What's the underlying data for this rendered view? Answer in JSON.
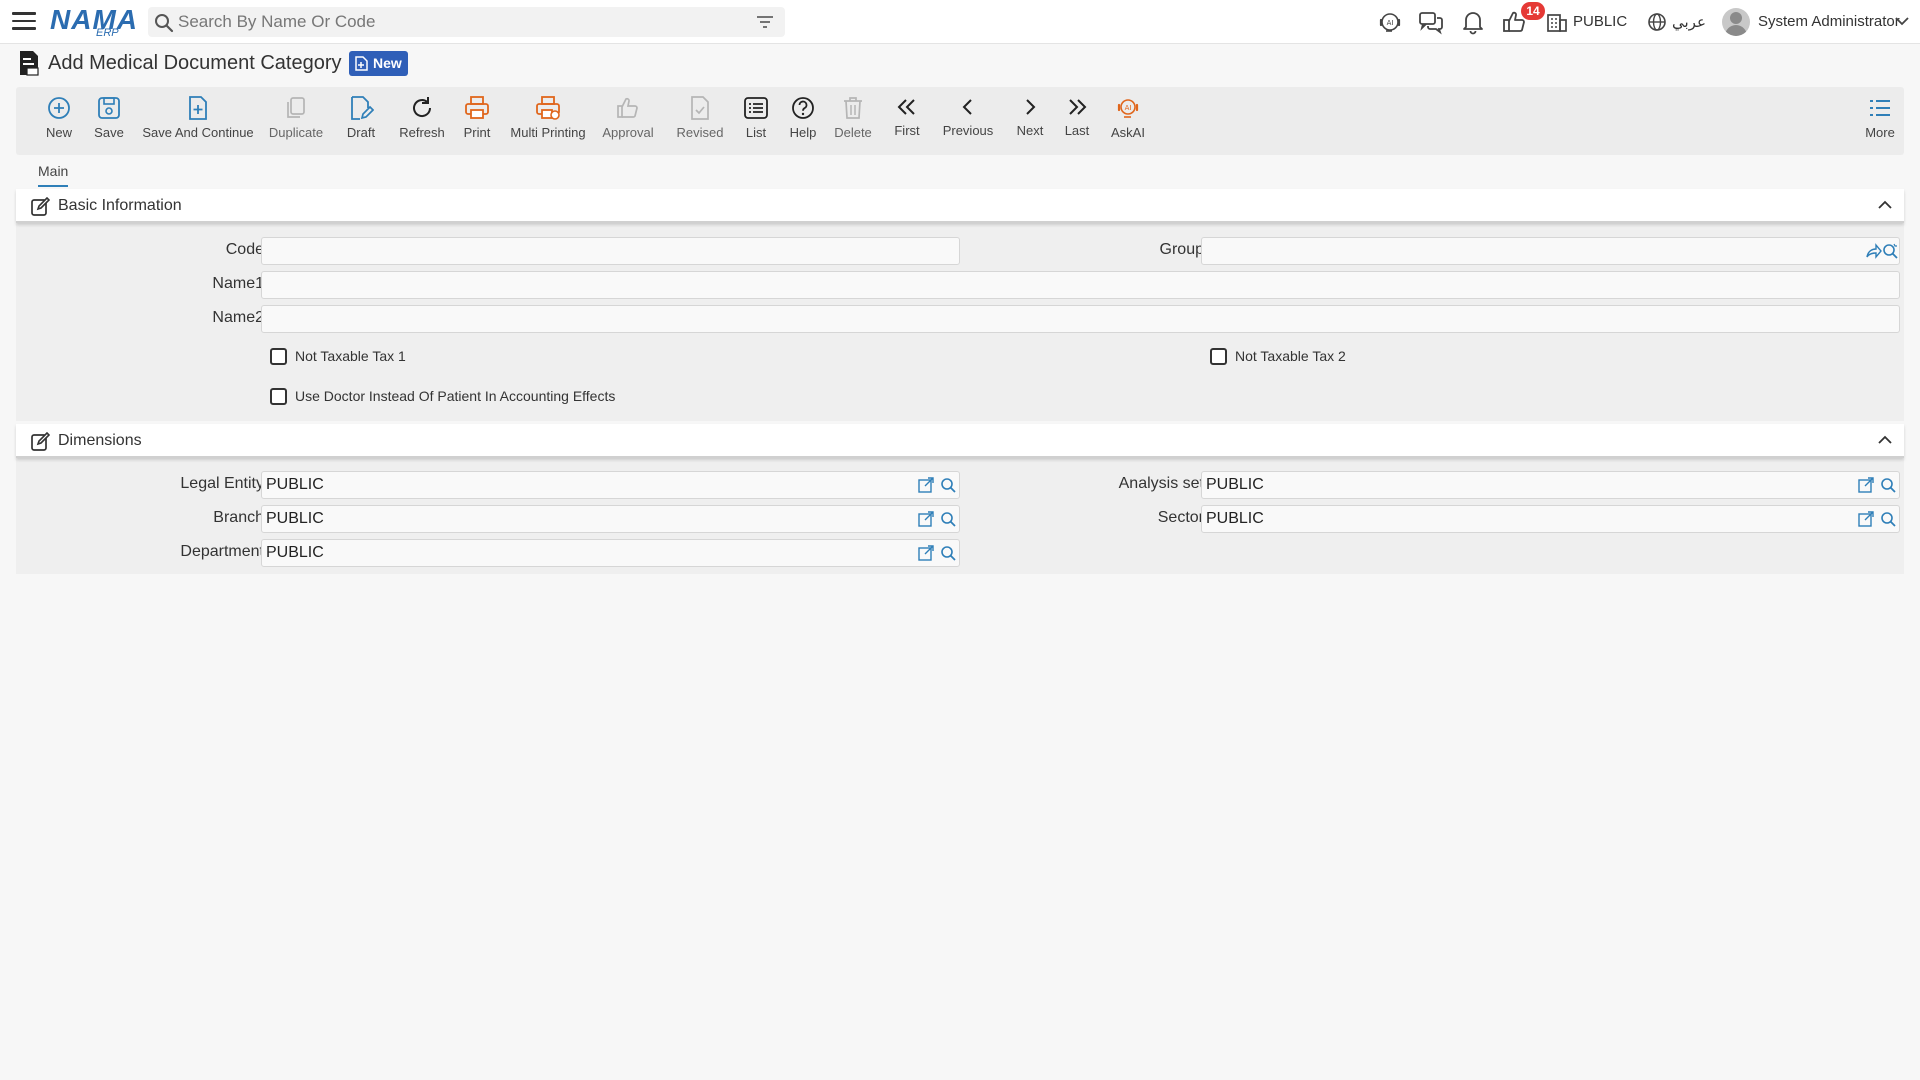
{
  "header": {
    "logo_main": "NAMA",
    "logo_sub": "ERP",
    "search_placeholder": "Search By Name Or Code",
    "notification_count": "14",
    "company": "PUBLIC",
    "language": "عربي",
    "user": "System Administrator"
  },
  "page": {
    "title": "Add Medical Document Category",
    "status_badge": "New"
  },
  "toolbar": {
    "new": "New",
    "save": "Save",
    "save_continue": "Save And Continue",
    "duplicate": "Duplicate",
    "draft": "Draft",
    "refresh": "Refresh",
    "print": "Print",
    "multi_printing": "Multi Printing",
    "approval": "Approval",
    "revised": "Revised",
    "list": "List",
    "help": "Help",
    "delete": "Delete",
    "first": "First",
    "previous": "Previous",
    "next": "Next",
    "last": "Last",
    "askai": "AskAI",
    "more": "More"
  },
  "tabs": {
    "main": "Main"
  },
  "basic_info": {
    "title": "Basic Information",
    "code_label": "Code",
    "code_value": "",
    "group_label": "Group",
    "group_value": "",
    "name1_label": "Name1",
    "name1_value": "",
    "name2_label": "Name2",
    "name2_value": "",
    "not_taxable_1": "Not Taxable Tax 1",
    "not_taxable_2": "Not Taxable Tax 2",
    "use_doctor": "Use Doctor Instead Of Patient In Accounting Effects"
  },
  "dimensions": {
    "title": "Dimensions",
    "legal_entity_label": "Legal Entity",
    "legal_entity_value": "PUBLIC",
    "analysis_set_label": "Analysis set",
    "analysis_set_value": "PUBLIC",
    "branch_label": "Branch",
    "branch_value": "PUBLIC",
    "sector_label": "Sector",
    "sector_value": "PUBLIC",
    "department_label": "Department",
    "department_value": "PUBLIC"
  },
  "colors": {
    "accent_blue": "#2f7fb8",
    "badge_blue": "#2f5fb8",
    "print_orange": "#e0661c",
    "notification_red": "#e53935"
  }
}
